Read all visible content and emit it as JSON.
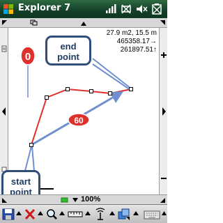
{
  "window": {
    "title": "Explorer 7"
  },
  "map_info": {
    "area_distance": "27.9 m2, 15.5 m",
    "easting": "465358.17",
    "northing": "261897.51"
  },
  "badges": {
    "start_marker": "0",
    "segment_length": "60"
  },
  "callouts": {
    "end_point": [
      "end",
      "point"
    ],
    "start_point": [
      "start",
      "point"
    ]
  },
  "status": {
    "zoom": "100%"
  },
  "colors": {
    "title_bar": "#14422a",
    "track_line": "#e0302c",
    "measure_arrow": "#6f8fd0",
    "badge": "#e0302c",
    "callout_border": "#2f4f7a"
  },
  "icons": {
    "title_bar": [
      "windows-logo-icon",
      "signal-icon",
      "connectivity-icon",
      "volume-mute-icon",
      "battery-icon"
    ],
    "toolbar": [
      "save-icon",
      "menu-arrow-icon",
      "delete-icon",
      "menu-arrow-icon",
      "zoom-icon",
      "menu-arrow-icon",
      "ruler-icon",
      "menu-arrow-icon",
      "gps-antenna-icon",
      "menu-arrow-icon",
      "layers-icon",
      "menu-arrow-icon",
      "keyboard-icon"
    ]
  }
}
